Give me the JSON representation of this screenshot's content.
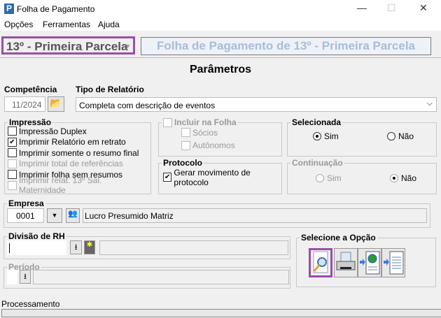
{
  "window": {
    "title": "Folha de Pagamento",
    "logo": "P",
    "minimize": "—",
    "maximize": "☐",
    "close": "✕"
  },
  "menu": [
    "Opções",
    "Ferramentas",
    "Ajuda"
  ],
  "header": {
    "type_select": "13º - Primeira Parcela",
    "banner": "Folha de Pagamento de 13º - Primeira Parcela",
    "heading": "Parâmetros"
  },
  "competencia": {
    "label": "Competência",
    "value": "11/2024"
  },
  "tipo": {
    "label": "Tipo de Relatório",
    "value": "Completa com descrição de eventos"
  },
  "impressao": {
    "label": "Impressão",
    "items": [
      {
        "label": "Impressão Duplex",
        "checked": false,
        "disabled": false
      },
      {
        "label": "Imprimir Relatório em retrato",
        "checked": true,
        "disabled": false
      },
      {
        "label": "Imprimir somente o resumo final",
        "checked": false,
        "disabled": false
      },
      {
        "label": "Imprimir total de referências",
        "checked": false,
        "disabled": true
      },
      {
        "label": "Imprimir folha sem resumos",
        "checked": false,
        "disabled": false
      },
      {
        "label": "Imprimir relat. 13º Sal. Maternidade",
        "checked": false,
        "disabled": true
      }
    ]
  },
  "incluir": {
    "label": "Incluir na Folha",
    "socios": "Sócios",
    "autonomos": "Autônomos"
  },
  "protocolo": {
    "label": "Protocolo",
    "item": "Gerar movimento de protocolo"
  },
  "selecionada": {
    "label": "Selecionada",
    "sim": "Sim",
    "nao": "Não",
    "value": "Sim"
  },
  "continuacao": {
    "label": "Continuação",
    "sim": "Sim",
    "nao": "Não",
    "value": "Não"
  },
  "empresa": {
    "label": "Empresa",
    "code": "0001",
    "name": "Lucro Presumido Matriz"
  },
  "divisao": {
    "label": "Divisão de RH",
    "value": ""
  },
  "periodo": {
    "label": "Período"
  },
  "opcao": {
    "label": "Selecione a Opção"
  },
  "status": {
    "label": "Processamento"
  }
}
